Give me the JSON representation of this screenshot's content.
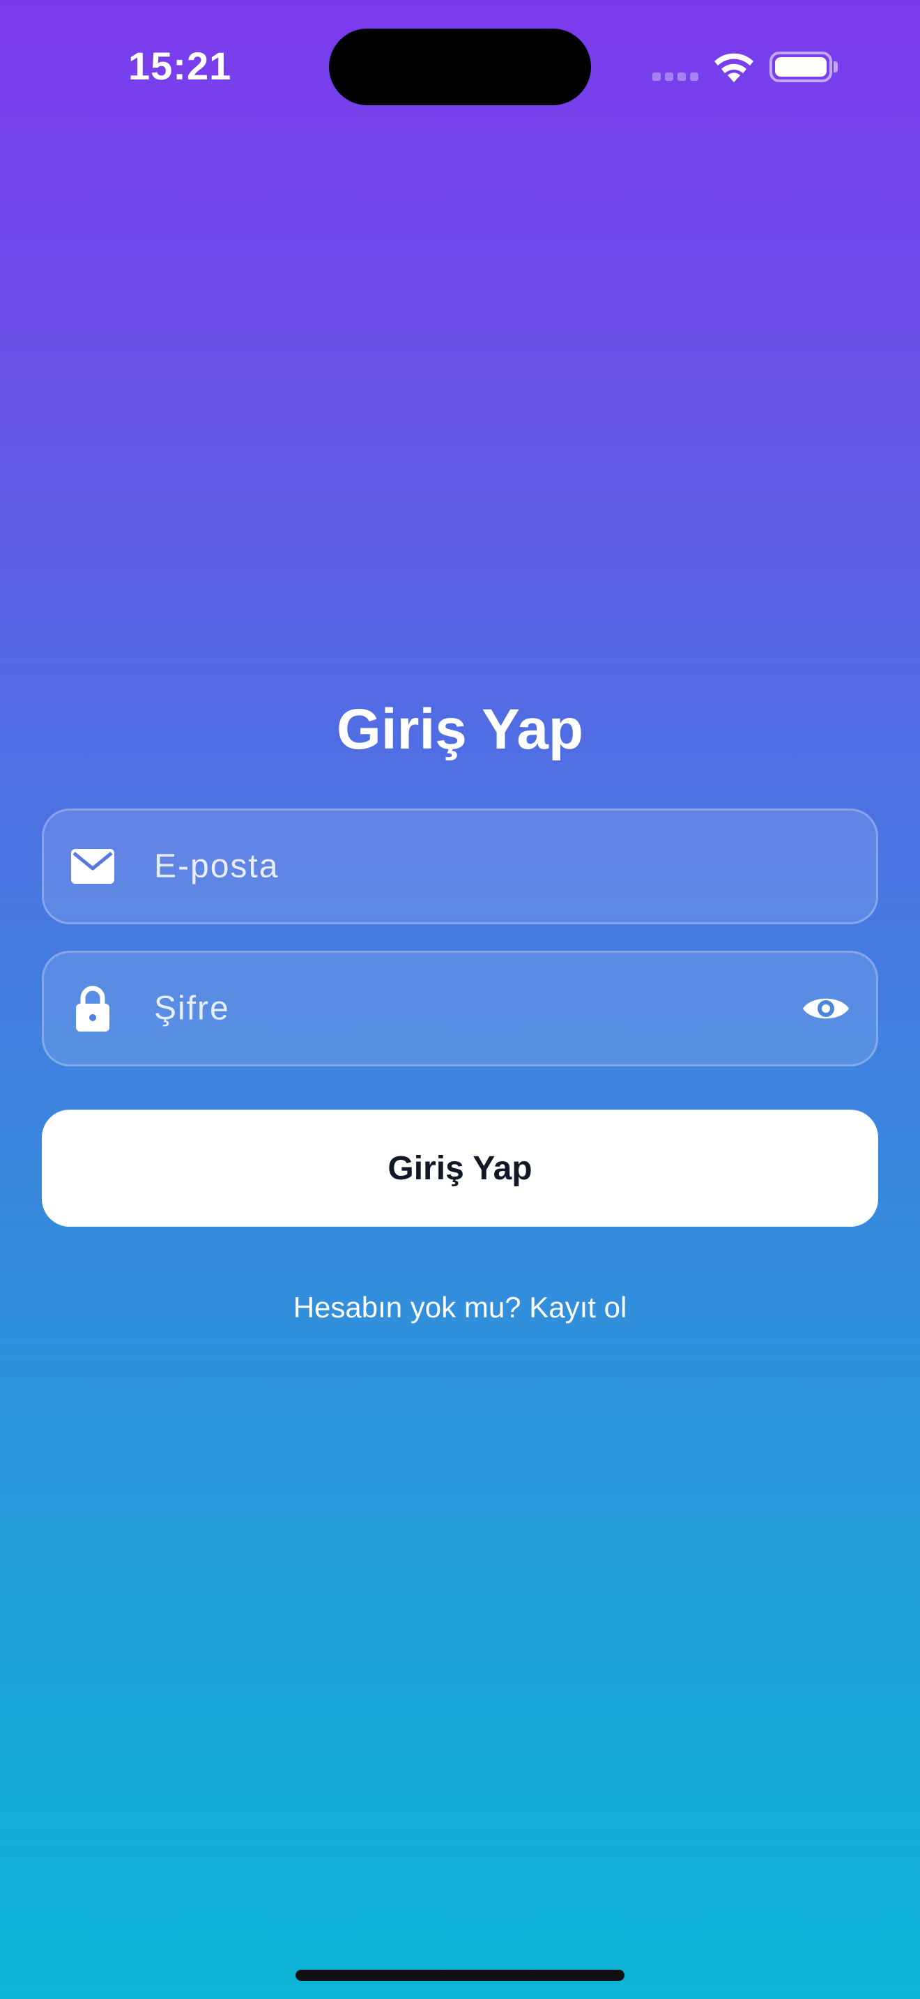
{
  "status_bar": {
    "time": "15:21",
    "icons": [
      "signal-icon",
      "wifi-icon",
      "battery-icon"
    ]
  },
  "login": {
    "title": "Giriş Yap",
    "email": {
      "placeholder": "E-posta",
      "value": "",
      "icon": "mail-icon"
    },
    "password": {
      "placeholder": "Şifre",
      "value": "",
      "icon": "lock-icon",
      "toggle_icon": "eye-icon"
    },
    "submit_label": "Giriş Yap",
    "register_link": "Hesabın yok mu? Kayıt ol"
  },
  "colors": {
    "gradient_top": "#7c3aed",
    "gradient_bottom": "#0bb4d6",
    "button_bg": "#ffffff",
    "button_text": "#111827"
  }
}
